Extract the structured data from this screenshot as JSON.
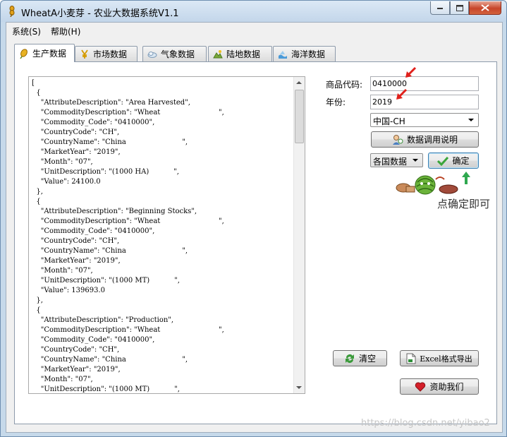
{
  "window": {
    "title": "WheatA小麦芽 - 农业大数据系统V1.1"
  },
  "menu": [
    {
      "label": "系统(S)"
    },
    {
      "label": "帮助(H)"
    }
  ],
  "tabs": [
    {
      "label": "生产数据",
      "icon": "wheat-icon",
      "active": true
    },
    {
      "label": "市场数据",
      "icon": "yen-icon"
    },
    {
      "label": "气象数据",
      "icon": "cloud-icon"
    },
    {
      "label": "陆地数据",
      "icon": "land-icon"
    },
    {
      "label": "海洋数据",
      "icon": "ocean-icon"
    }
  ],
  "form": {
    "commodity_code_label": "商品代码:",
    "commodity_code_value": "0410000",
    "year_label": "年份:",
    "year_value": "2019",
    "country_select": "中国-CH",
    "api_help_button": "数据调用说明",
    "scope_select": "各国数据",
    "confirm_button": "确定",
    "hint_text": "点确定即可",
    "clear_button": "清空",
    "export_button": "Excel格式导出",
    "donate_button": "资助我们"
  },
  "json_output": "[\n  {\n    \"AttributeDescription\": \"Area Harvested\",\n    \"CommodityDescription\": \"Wheat                          \",\n    \"Commodity_Code\": \"0410000\",\n    \"CountryCode\": \"CH\",\n    \"CountryName\": \"China                         \",\n    \"MarketYear\": \"2019\",\n    \"Month\": \"07\",\n    \"UnitDescription\": \"(1000 HA)           \",\n    \"Value\": 24100.0\n  },\n  {\n    \"AttributeDescription\": \"Beginning Stocks\",\n    \"CommodityDescription\": \"Wheat                          \",\n    \"Commodity_Code\": \"0410000\",\n    \"CountryCode\": \"CH\",\n    \"CountryName\": \"China                         \",\n    \"MarketYear\": \"2019\",\n    \"Month\": \"07\",\n    \"UnitDescription\": \"(1000 MT)           \",\n    \"Value\": 139693.0\n  },\n  {\n    \"AttributeDescription\": \"Production\",\n    \"CommodityDescription\": \"Wheat                          \",\n    \"Commodity_Code\": \"0410000\",\n    \"CountryCode\": \"CH\",\n    \"CountryName\": \"China                         \",\n    \"MarketYear\": \"2019\",\n    \"Month\": \"07\",\n    \"UnitDescription\": \"(1000 MT)           \",",
  "watermark": "https://blog.csdn.net/yibao2",
  "colors": {
    "title_bar": "#c6d9ea",
    "close_button": "#c7452a",
    "annotation_arrow_red": "#e0201b",
    "annotation_arrow_green": "#2fa84f"
  }
}
